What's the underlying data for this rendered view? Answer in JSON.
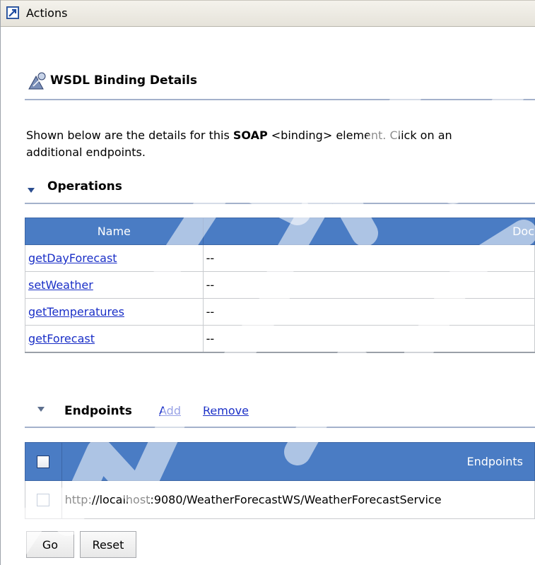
{
  "header": {
    "title": "Actions",
    "icon": "arrow-out-icon"
  },
  "page": {
    "title": "WSDL Binding Details",
    "intro_prefix": "Shown below are the details for this ",
    "intro_bold": "SOAP",
    "intro_suffix": " <binding> element. Click on an",
    "intro_line2": "additional endpoints."
  },
  "operations": {
    "section_title": "Operations",
    "columns": [
      "Name",
      "Doc"
    ],
    "rows": [
      {
        "name": "getDayForecast",
        "doc": "--"
      },
      {
        "name": "setWeather",
        "doc": "--"
      },
      {
        "name": "getTemperatures",
        "doc": "--"
      },
      {
        "name": "getForecast",
        "doc": "--"
      }
    ]
  },
  "endpoints": {
    "section_title": "Endpoints",
    "add_label": "Add",
    "remove_label": "Remove",
    "column": "Endpoints",
    "rows": [
      {
        "url": "http://localhost:9080/WeatherForecastWS/WeatherForecastService",
        "checked": false
      }
    ]
  },
  "buttons": {
    "go": "Go",
    "reset": "Reset"
  },
  "colors": {
    "header_blue": "#4a7cc4",
    "link": "#1a2fc7",
    "rule": "#a3b1cb"
  }
}
